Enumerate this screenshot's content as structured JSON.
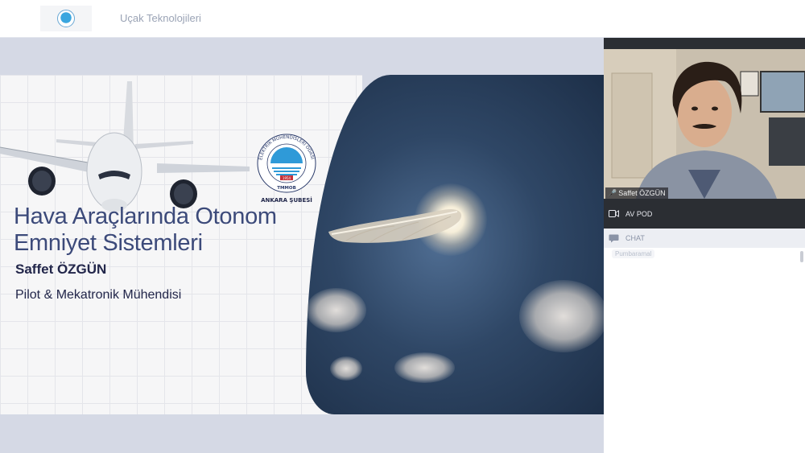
{
  "header": {
    "room_title": "Uçak Teknolojileri",
    "logo_icon": "tmmob-emo-logo"
  },
  "slide": {
    "title_line1": "Hava Araçlarında Otonom",
    "title_line2": "Emniyet Sistemleri",
    "presenter": "Saffet ÖZGÜN",
    "role": "Pilot & Mekatronik Mühendisi",
    "logo_text_ring": "ELEKTRİK MÜHENDİSLERİ ODASI",
    "logo_org": "TMMOB",
    "logo_year": "1954",
    "logo_branch": "ANKARA ŞUBESİ"
  },
  "camera": {
    "participant_name": "Saffet ÖZGÜN",
    "mic_icon": "microphone-icon"
  },
  "panels": {
    "av_label": "AV POD",
    "av_icon": "video-camera-icon",
    "chat_label": "CHAT",
    "chat_icon": "chat-icon",
    "chat_faded_message": "Pumbaramal"
  },
  "colors": {
    "title": "#3c4a7a",
    "stage_bg": "#d5d9e5",
    "panel_dark": "#2b2e33"
  }
}
